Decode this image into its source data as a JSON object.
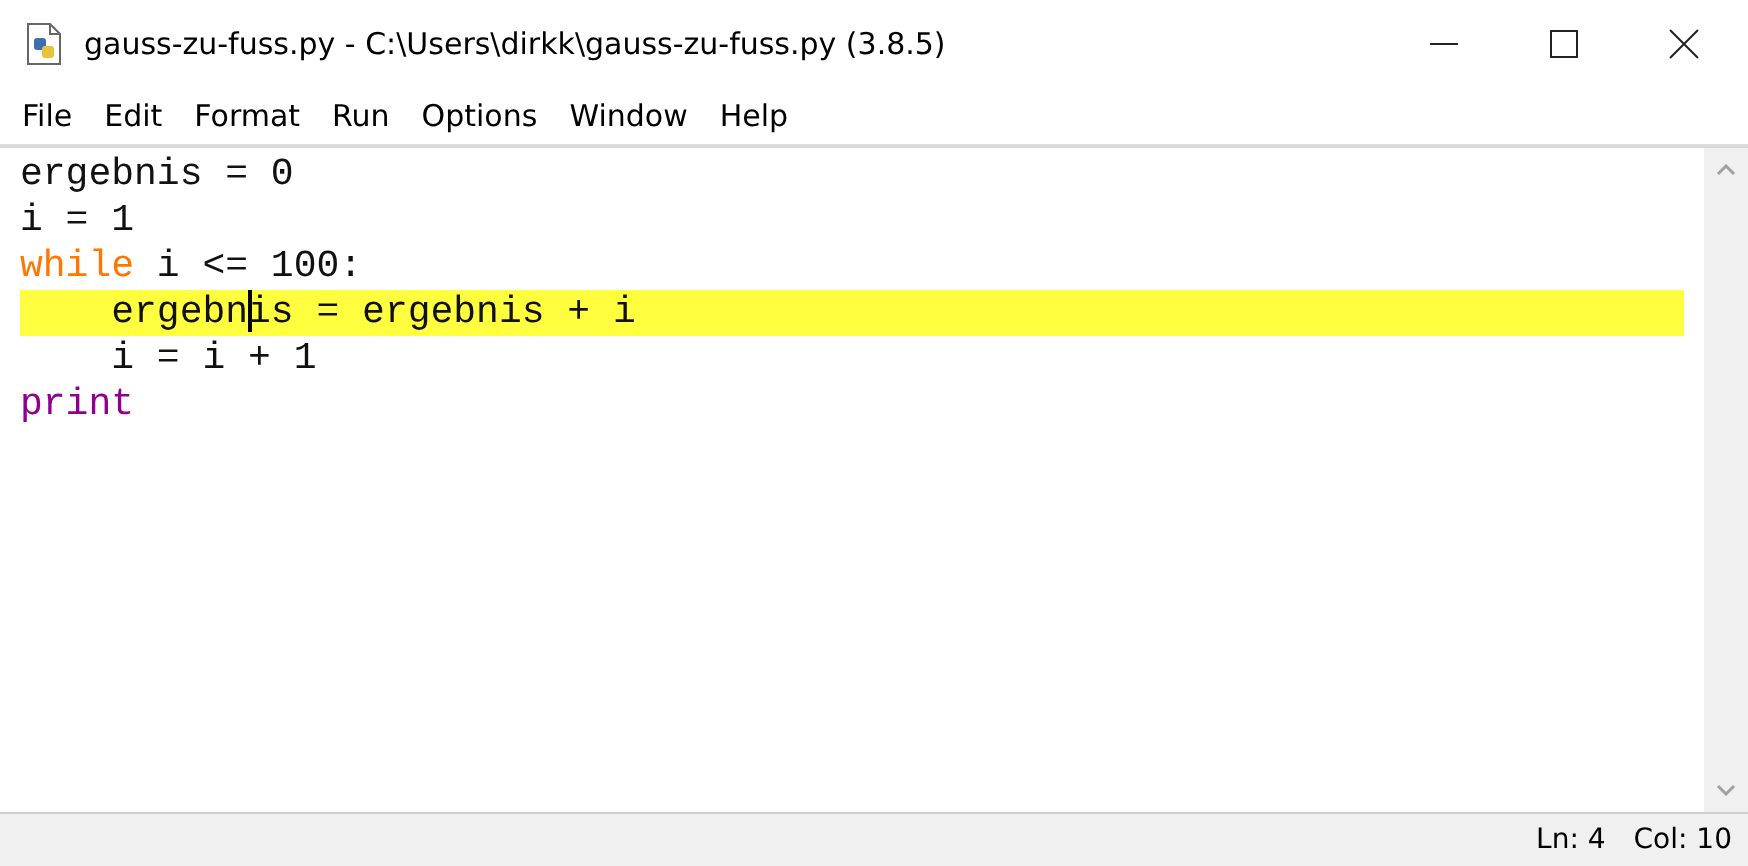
{
  "window": {
    "title": "gauss-zu-fuss.py - C:\\Users\\dirkk\\gauss-zu-fuss.py (3.8.5)"
  },
  "menu": [
    "File",
    "Edit",
    "Format",
    "Run",
    "Options",
    "Window",
    "Help"
  ],
  "editor": {
    "lines": [
      {
        "highlighted": false,
        "tokens": [
          {
            "kind": "plain",
            "text": "ergebnis = 0"
          }
        ]
      },
      {
        "highlighted": false,
        "tokens": [
          {
            "kind": "plain",
            "text": "i = 1"
          }
        ]
      },
      {
        "highlighted": false,
        "tokens": [
          {
            "kind": "keyword",
            "text": "while"
          },
          {
            "kind": "plain",
            "text": " i <= 100:"
          }
        ]
      },
      {
        "highlighted": true,
        "tokens": [
          {
            "kind": "plain",
            "text": "    ergebn"
          },
          {
            "kind": "plain",
            "text": "is = ergebnis + i",
            "cursor_before": true
          }
        ]
      },
      {
        "highlighted": false,
        "tokens": [
          {
            "kind": "plain",
            "text": "    i = i + 1"
          }
        ]
      },
      {
        "highlighted": false,
        "tokens": [
          {
            "kind": "builtin",
            "text": "print"
          }
        ]
      }
    ]
  },
  "status_bar": {
    "line": "Ln: 4",
    "column": "Col: 10"
  }
}
